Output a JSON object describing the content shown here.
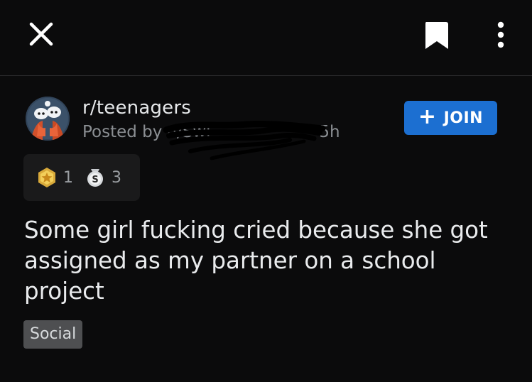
{
  "topbar": {
    "close_icon": "close-icon",
    "bookmark_icon": "bookmark-icon",
    "more_icon": "more-vertical-icon"
  },
  "post": {
    "subreddit": "r/teenagers",
    "posted_by_prefix": "Posted by",
    "author": "u/Swi",
    "age": "• 5h",
    "join_label": "JOIN",
    "awards": [
      {
        "icon": "gold-star-award-icon",
        "count": "1"
      },
      {
        "icon": "silver-award-icon",
        "count": "3"
      }
    ],
    "title": "Some girl fucking cried because she got assigned as my partner on a school project",
    "flair": "Social"
  },
  "colors": {
    "background": "#0b0b0c",
    "join_button": "#1c6fd1",
    "flair_bg": "#4e4f51",
    "award_bg": "#1a1a1b"
  }
}
